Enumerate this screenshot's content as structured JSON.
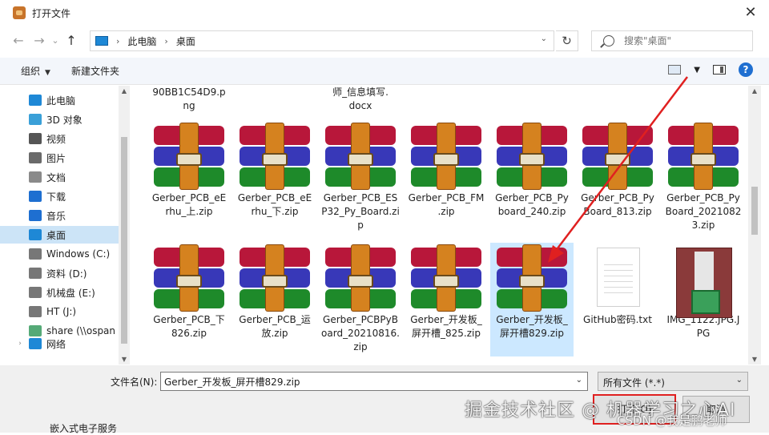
{
  "window": {
    "title": "打开文件",
    "close_glyph": "✕"
  },
  "nav": {
    "back_glyph": "←",
    "forward_glyph": "→",
    "recent_glyph": "⌄",
    "up_glyph": "↑",
    "breadcrumbs": [
      "此电脑",
      "桌面"
    ],
    "refresh_glyph": "↻",
    "search_placeholder": "搜索\"桌面\""
  },
  "toolbar": {
    "organize_label": "组织",
    "new_folder_label": "新建文件夹",
    "help_glyph": "?"
  },
  "sidebar": {
    "items": [
      {
        "label": "此电脑",
        "icon": "computer-icon",
        "level": 0,
        "selected": false
      },
      {
        "label": "3D 对象",
        "icon": "cube-icon",
        "level": 1,
        "selected": false
      },
      {
        "label": "视频",
        "icon": "video-icon",
        "level": 1,
        "selected": false
      },
      {
        "label": "图片",
        "icon": "picture-icon",
        "level": 1,
        "selected": false
      },
      {
        "label": "文档",
        "icon": "document-icon",
        "level": 1,
        "selected": false
      },
      {
        "label": "下载",
        "icon": "download-icon",
        "level": 1,
        "selected": false
      },
      {
        "label": "音乐",
        "icon": "music-icon",
        "level": 1,
        "selected": false
      },
      {
        "label": "桌面",
        "icon": "desktop-icon",
        "level": 1,
        "selected": true
      },
      {
        "label": "Windows (C:)",
        "icon": "drive-icon",
        "level": 1,
        "selected": false
      },
      {
        "label": "资料 (D:)",
        "icon": "drive-icon",
        "level": 1,
        "selected": false
      },
      {
        "label": "机械盘 (E:)",
        "icon": "drive-icon",
        "level": 1,
        "selected": false
      },
      {
        "label": "HT (J:)",
        "icon": "drive-icon",
        "level": 1,
        "selected": false
      },
      {
        "label": "share (\\\\ospan",
        "icon": "network-drive-icon",
        "level": 1,
        "selected": false
      },
      {
        "label": "网络",
        "icon": "network-icon",
        "level": 0,
        "selected": false
      }
    ]
  },
  "files_top_partial": [
    {
      "name": "90BB1C54D9.p\nng"
    },
    {
      "name": "师_信息填写.\ndocx"
    }
  ],
  "files": [
    {
      "name": "Gerber_PCB_eE\nrhu_上.zip",
      "type": "zip",
      "selected": false
    },
    {
      "name": "Gerber_PCB_eE\nrhu_下.zip",
      "type": "zip",
      "selected": false
    },
    {
      "name": "Gerber_PCB_ES\nP32_Py_Board.zi\np",
      "type": "zip",
      "selected": false
    },
    {
      "name": "Gerber_PCB_FM\n.zip",
      "type": "zip",
      "selected": false
    },
    {
      "name": "Gerber_PCB_Py\nboard_240.zip",
      "type": "zip",
      "selected": false
    },
    {
      "name": "Gerber_PCB_Py\nBoard_813.zip",
      "type": "zip",
      "selected": false
    },
    {
      "name": "Gerber_PCB_Py\nBoard_2021082\n3.zip",
      "type": "zip",
      "selected": false
    },
    {
      "name": "Gerber_PCB_下\n826.zip",
      "type": "zip",
      "selected": false
    },
    {
      "name": "Gerber_PCB_运\n放.zip",
      "type": "zip",
      "selected": false
    },
    {
      "name": "Gerber_PCBPyB\noard_20210816.\nzip",
      "type": "zip",
      "selected": false
    },
    {
      "name": "Gerber_开发板_\n屏开槽_825.zip",
      "type": "zip",
      "selected": false
    },
    {
      "name": "Gerber_开发板_\n屏开槽829.zip",
      "type": "zip",
      "selected": true
    },
    {
      "name": "GitHub密码.txt",
      "type": "txt",
      "selected": false
    },
    {
      "name": "IMG_1122.JPG.J\nPG",
      "type": "jpg",
      "selected": false
    }
  ],
  "bottom": {
    "filename_label": "文件名(N):",
    "filename_value": "Gerber_开发板_屏开槽829.zip",
    "filetype_value": "所有文件 (*.*)",
    "open_label": "打开(O)",
    "cancel_label": "取消",
    "partial_text": "嵌入式电子服务"
  },
  "watermark": {
    "line1": "掘金技术社区 @ 机器学习之心AI",
    "line2": "CSDN @我是鹏老师"
  },
  "colors": {
    "accent": "#1f6fd1",
    "selection": "#cce8ff",
    "highlight": "#e02020"
  }
}
